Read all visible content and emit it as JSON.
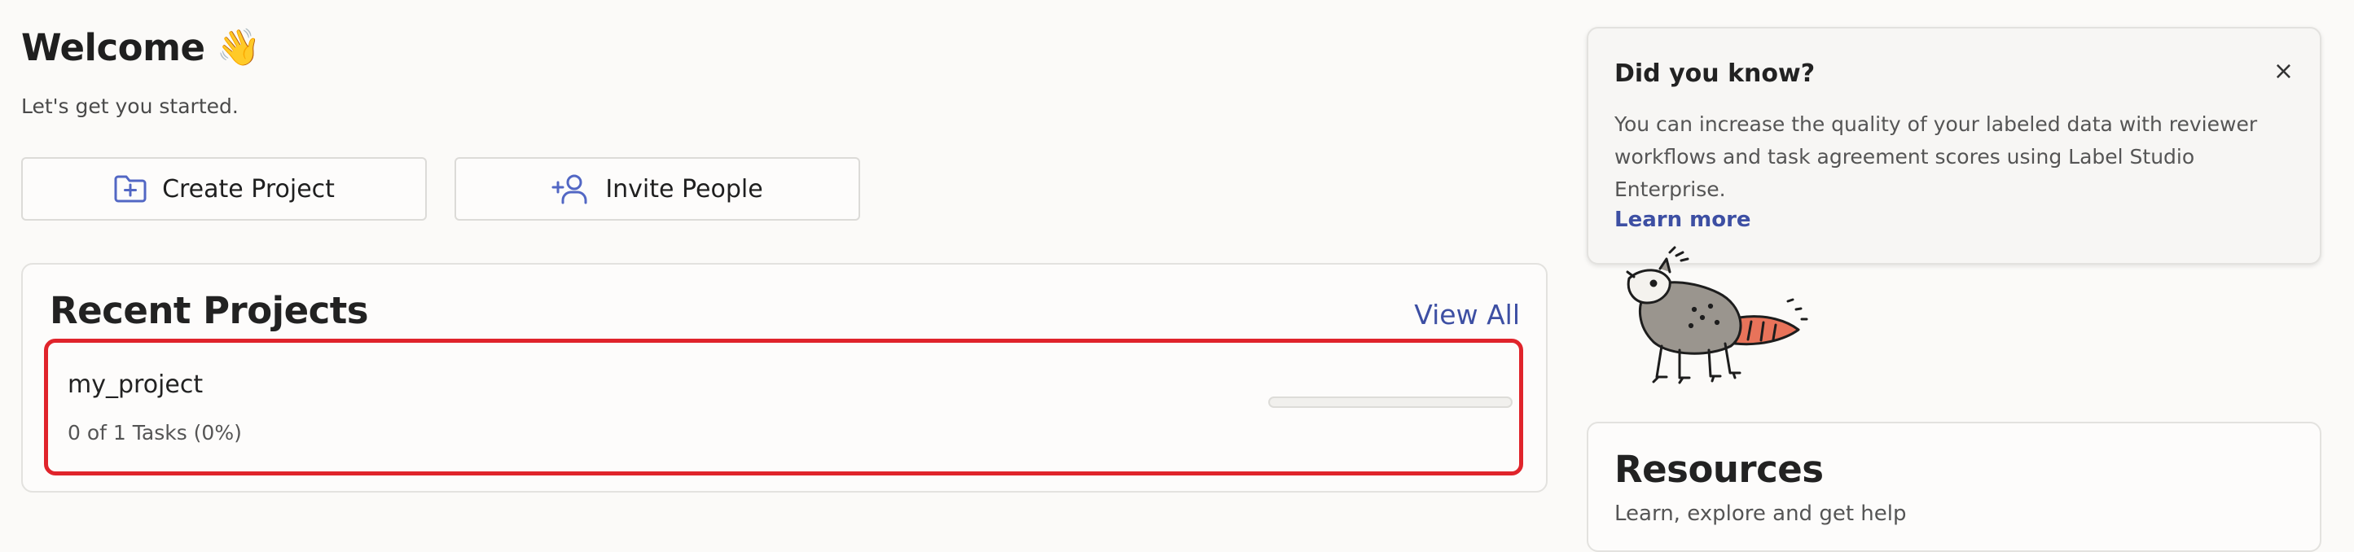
{
  "welcome": {
    "title": "Welcome",
    "emoji": "👋",
    "subtitle": "Let's get you started."
  },
  "actions": {
    "create_project": "Create Project",
    "invite_people": "Invite People"
  },
  "recent_projects": {
    "title": "Recent Projects",
    "view_all": "View All",
    "items": [
      {
        "name": "my_project",
        "stats": "0 of 1 Tasks (0%)",
        "progress": 0
      }
    ]
  },
  "tip": {
    "title": "Did you know?",
    "close_symbol": "×",
    "body": "You can increase the quality of your labeled data with reviewer workflows and task agreement scores using Label Studio Enterprise.",
    "link": "Learn more"
  },
  "resources": {
    "title": "Resources",
    "subtitle": "Learn, explore and get help"
  },
  "colors": {
    "accent": "#3d4fa3",
    "highlight_border": "#e0242b",
    "opossum_tail": "#e8735a"
  },
  "icons": {
    "create_project": "folder-plus-icon",
    "invite_people": "user-plus-icon",
    "wave": "waving-hand-icon",
    "close": "close-icon",
    "mascot": "opossum-mascot"
  }
}
